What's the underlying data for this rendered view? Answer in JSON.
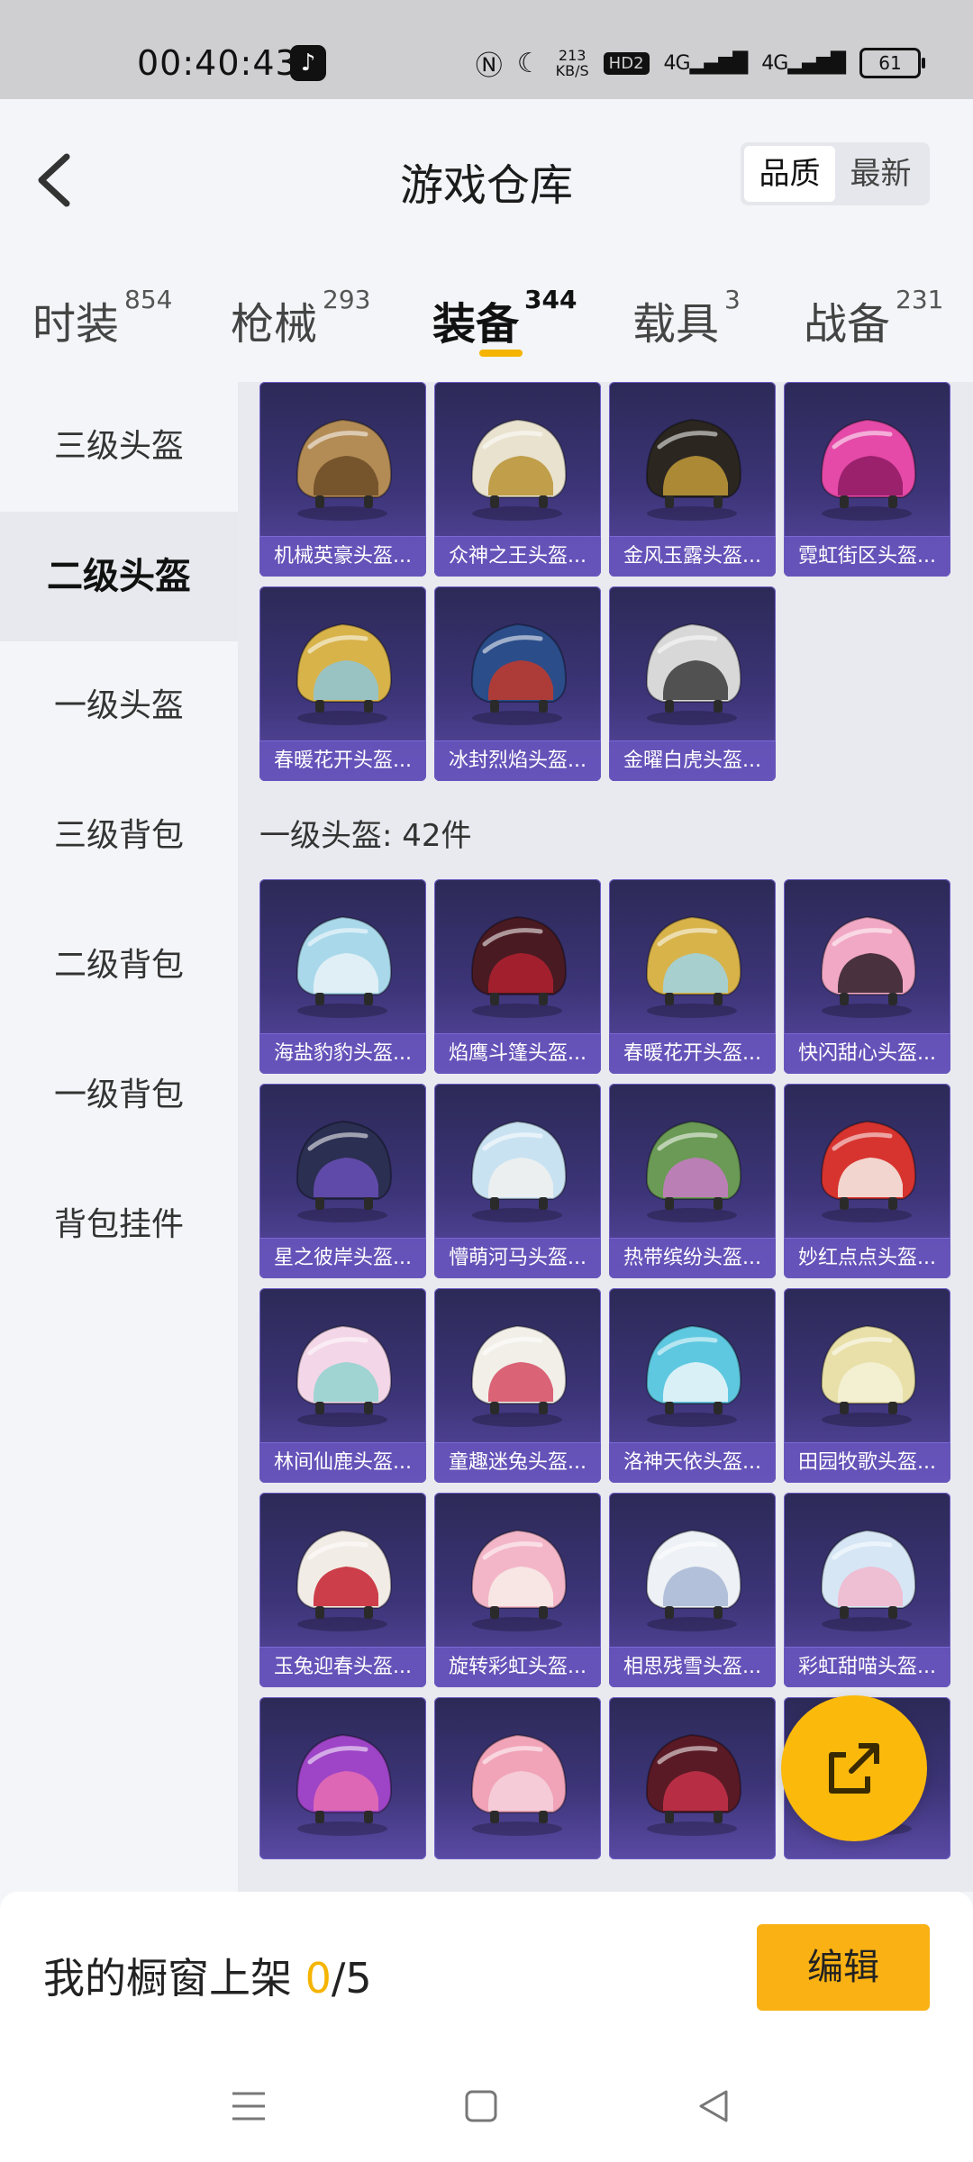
{
  "status_bar": {
    "time": "00:40:43",
    "net_speed_top": "213",
    "net_speed_bottom": "KB/S",
    "hd": "HD2",
    "signal1": "4G",
    "signal2": "4G",
    "battery": "61"
  },
  "header": {
    "title": "游戏仓库",
    "sort_options": [
      "品质",
      "最新"
    ],
    "sort_selected": "品质"
  },
  "tabs": [
    {
      "label": "时装",
      "count": "854"
    },
    {
      "label": "枪械",
      "count": "293"
    },
    {
      "label": "装备",
      "count": "344"
    },
    {
      "label": "载具",
      "count": "3"
    },
    {
      "label": "战备",
      "count": "231"
    }
  ],
  "active_tab": "装备",
  "sidebar": {
    "items": [
      "三级头盔",
      "二级头盔",
      "一级头盔",
      "三级背包",
      "二级背包",
      "一级背包",
      "背包挂件"
    ],
    "active": "二级头盔"
  },
  "sections": [
    {
      "label": "",
      "items": [
        {
          "name": "机械英豪头盔...",
          "icon": "helmet-bronze-mech"
        },
        {
          "name": "众神之王头盔...",
          "icon": "helmet-white-gold"
        },
        {
          "name": "金风玉露头盔...",
          "icon": "helmet-black-gold"
        },
        {
          "name": "霓虹街区头盔...",
          "icon": "helmet-pink-neon"
        },
        {
          "name": "春暖花开头盔...",
          "icon": "helmet-gold-flower"
        },
        {
          "name": "冰封烈焰头盔...",
          "icon": "helmet-blue-flame"
        },
        {
          "name": "金曜白虎头盔...",
          "icon": "helmet-white-tiger"
        }
      ]
    },
    {
      "label": "一级头盔: 42件",
      "items": [
        {
          "name": "海盐豹豹头盔...",
          "icon": "helmet-light-blue"
        },
        {
          "name": "焰鹰斗篷头盔...",
          "icon": "helmet-dark-red"
        },
        {
          "name": "春暖花开头盔...",
          "icon": "helmet-gold-flower-open"
        },
        {
          "name": "快闪甜心头盔...",
          "icon": "helmet-pink-heart"
        },
        {
          "name": "星之彼岸头盔...",
          "icon": "helmet-navy-star"
        },
        {
          "name": "懵萌河马头盔...",
          "icon": "helmet-pale-blue"
        },
        {
          "name": "热带缤纷头盔...",
          "icon": "helmet-tropical-flowers"
        },
        {
          "name": "妙红点点头盔...",
          "icon": "helmet-red-dots"
        },
        {
          "name": "林间仙鹿头盔...",
          "icon": "helmet-fawn-pastel"
        },
        {
          "name": "童趣迷兔头盔...",
          "icon": "helmet-bunny-white"
        },
        {
          "name": "洛神天依头盔...",
          "icon": "helmet-cyan-white"
        },
        {
          "name": "田园牧歌头盔...",
          "icon": "helmet-cream"
        },
        {
          "name": "玉兔迎春头盔...",
          "icon": "helmet-red-white"
        },
        {
          "name": "旋转彩虹头盔...",
          "icon": "helmet-pink-white"
        },
        {
          "name": "相思残雪头盔...",
          "icon": "helmet-snow-white"
        },
        {
          "name": "彩虹甜喵头盔...",
          "icon": "helmet-pastel-cat"
        },
        {
          "name": "",
          "icon": "helmet-purple-pink"
        },
        {
          "name": "",
          "icon": "helmet-pink-pig"
        },
        {
          "name": "",
          "icon": "helmet-dark-red-stripe"
        },
        {
          "name": "",
          "icon": "helmet-hidden"
        }
      ]
    }
  ],
  "colors": {
    "accent": "#f5b400",
    "card_bg": "#3c3477",
    "card_label_bg": "#6856be",
    "edit_button": "#f9b114",
    "fab": "#fbb90c"
  },
  "bottom_bar": {
    "prefix": "我的橱窗上架 ",
    "count": "0",
    "total": "/5",
    "edit_label": "编辑"
  },
  "icons": {
    "back": "back-chevron-icon",
    "share": "share-export-icon",
    "nav_menu": "menu-icon",
    "nav_home": "home-square-icon",
    "nav_back": "back-triangle-icon"
  }
}
